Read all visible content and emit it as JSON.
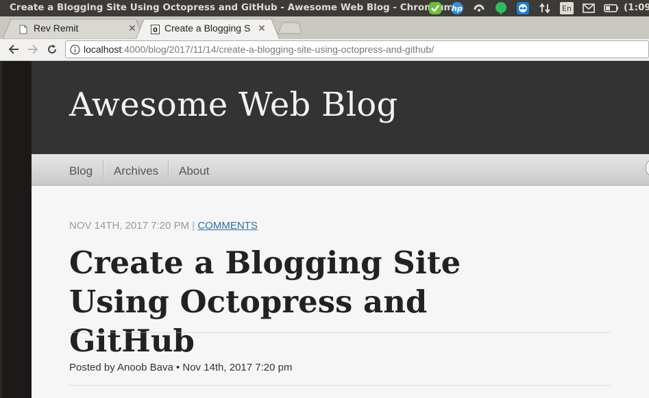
{
  "system_bar": {
    "window_title": "Create a Blogging Site Using Octopress and GitHub - Awesome Web Blog - Chromium",
    "keyboard_layout": "En",
    "clock": "(1:09,",
    "tray_icons": [
      "checkmark-app-icon",
      "hp-icon",
      "sync-icon",
      "evernote-icon",
      "teamviewer-icon",
      "network-icon",
      "keyboard-layout-icon",
      "mail-icon",
      "battery-icon"
    ]
  },
  "tabs": [
    {
      "label": "Rev Remit",
      "icon": "page-icon",
      "active": false
    },
    {
      "label": "Create a Blogging S",
      "icon": "octopress-favicon",
      "active": true
    }
  ],
  "address_bar": {
    "host": "localhost",
    "path": ":4000/blog/2017/11/14/create-a-blogging-site-using-octopress-and-github/"
  },
  "blog": {
    "title": "Awesome Web Blog",
    "nav": [
      "Blog",
      "Archives",
      "About"
    ]
  },
  "post": {
    "date": "NOV 14TH, 2017 7:20 PM",
    "separator": "|",
    "comments_link": "COMMENTS",
    "title": "Create a Blogging Site Using Octopress and GitHub",
    "byline": "Posted by Anoob Bava  •  Nov 14th, 2017 7:20 pm"
  },
  "colors": {
    "header_bg": "#333333",
    "link": "#2a6ea6",
    "topbar_bg": "#3c3b37"
  }
}
